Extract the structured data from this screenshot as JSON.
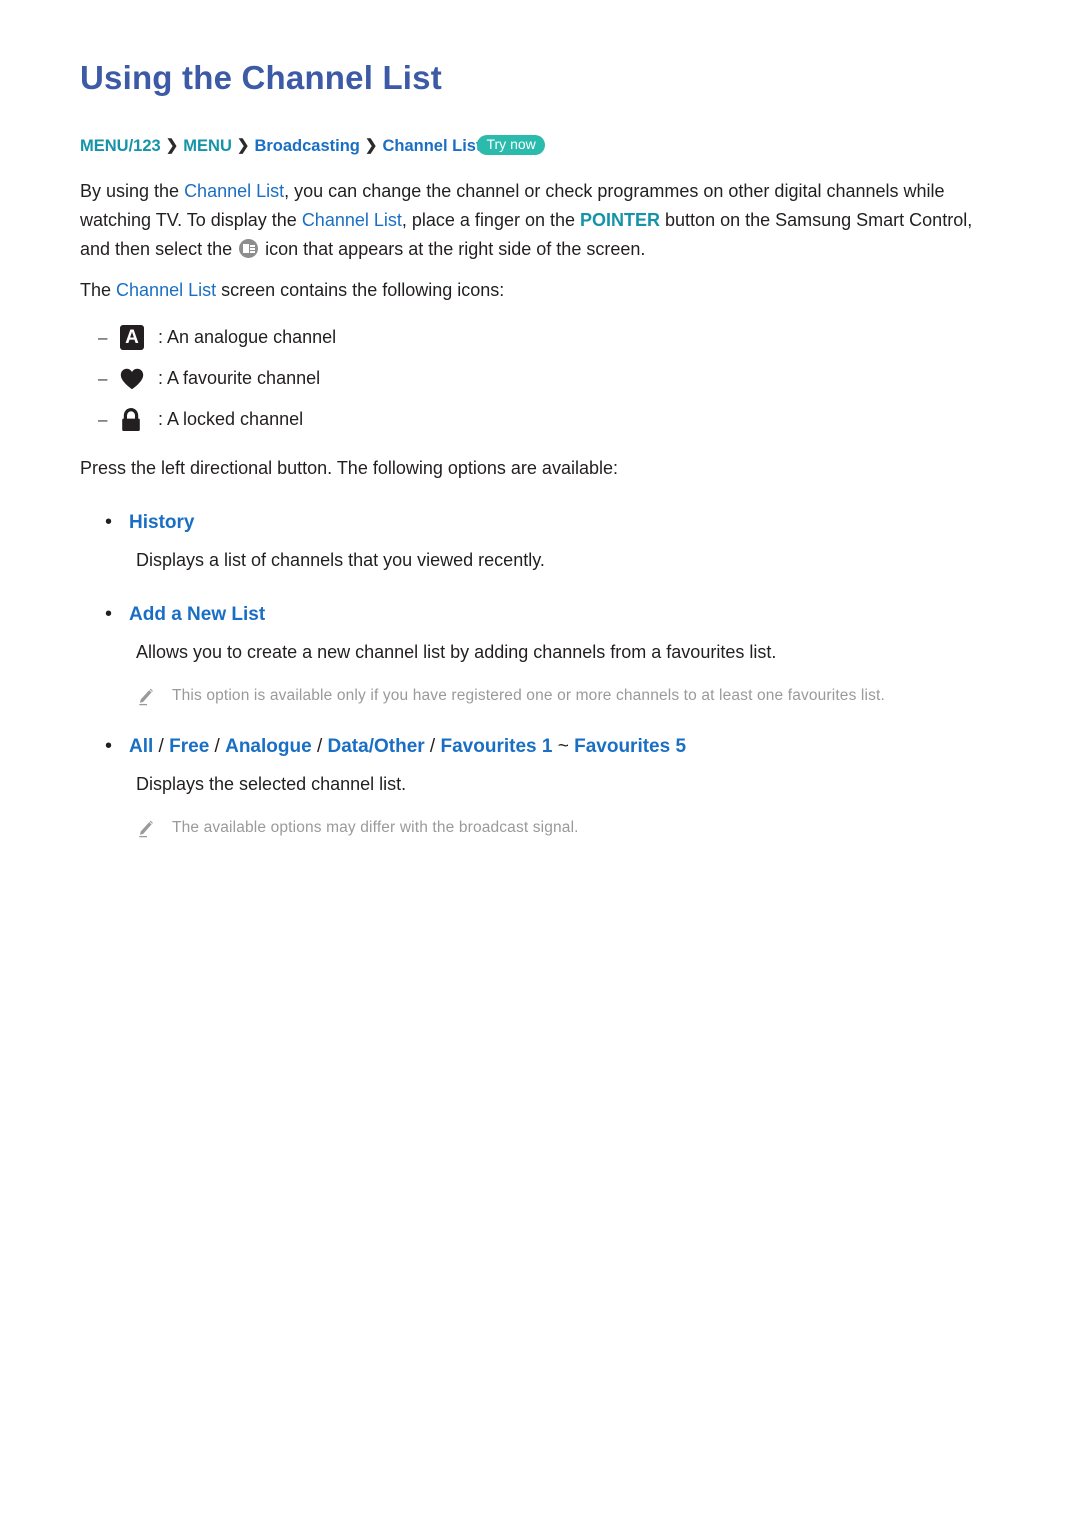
{
  "page": {
    "title": "Using the Channel List",
    "colors": {
      "title_blue": "#3c5aa6",
      "link_blue": "#1a6fc4",
      "teal": "#1593a8",
      "badge_teal": "#2bbbad",
      "note_grey": "#9a9a9a",
      "body_text": "#231f20"
    }
  },
  "breadcrumb": {
    "items": [
      {
        "label": "MENU/123",
        "style": "teal"
      },
      {
        "label": "MENU",
        "style": "teal"
      },
      {
        "label": "Broadcasting",
        "style": "blue"
      },
      {
        "label": "Channel List",
        "style": "blue"
      }
    ],
    "separator": "❯",
    "badge": "Try now"
  },
  "intro": {
    "p1_a": "By using the ",
    "p1_link1": "Channel List",
    "p1_b": ", you can change the channel or check programmes on other digital channels while watching TV. To display the ",
    "p1_link2": "Channel List",
    "p1_c": ", place a finger on the ",
    "p1_pointer": "POINTER",
    "p1_d": " button on the Samsung Smart Control, and then select the ",
    "p1_icon_name": "channel-list-icon",
    "p1_e": " icon that appears at the right side of the screen.",
    "p2_a": "The ",
    "p2_link": "Channel List",
    "p2_b": " screen contains the following icons:"
  },
  "icon_list": {
    "dash": "–",
    "items": [
      {
        "icon": "analogue-channel-icon",
        "glyph": "A",
        "text": ": An analogue channel"
      },
      {
        "icon": "favourite-channel-icon",
        "glyph": "",
        "text": ": A favourite channel"
      },
      {
        "icon": "locked-channel-icon",
        "glyph": "",
        "text": ": A locked channel"
      }
    ]
  },
  "options_intro": "Press the left directional button. The following options are available:",
  "options": [
    {
      "bullet": "•",
      "label": "History",
      "description": "Displays a list of channels that you viewed recently.",
      "note": null
    },
    {
      "bullet": "•",
      "label": "Add a New List",
      "description": "Allows you to create a new channel list by adding channels from a favourites list.",
      "note": "This option is available only if you have registered one or more channels to at least one favourites list."
    },
    {
      "bullet": "•",
      "label_parts": [
        {
          "t": "All",
          "k": "link"
        },
        {
          "t": " / ",
          "k": "sep"
        },
        {
          "t": "Free",
          "k": "link"
        },
        {
          "t": " / ",
          "k": "sep"
        },
        {
          "t": "Analogue",
          "k": "link"
        },
        {
          "t": " / ",
          "k": "sep"
        },
        {
          "t": "Data/Other",
          "k": "link"
        },
        {
          "t": " / ",
          "k": "sep"
        },
        {
          "t": "Favourites 1",
          "k": "link"
        },
        {
          "t": " ~ ",
          "k": "sep"
        },
        {
          "t": "Favourites 5",
          "k": "link"
        }
      ],
      "description": "Displays the selected channel list.",
      "note": "The available options may differ with the broadcast signal."
    }
  ]
}
